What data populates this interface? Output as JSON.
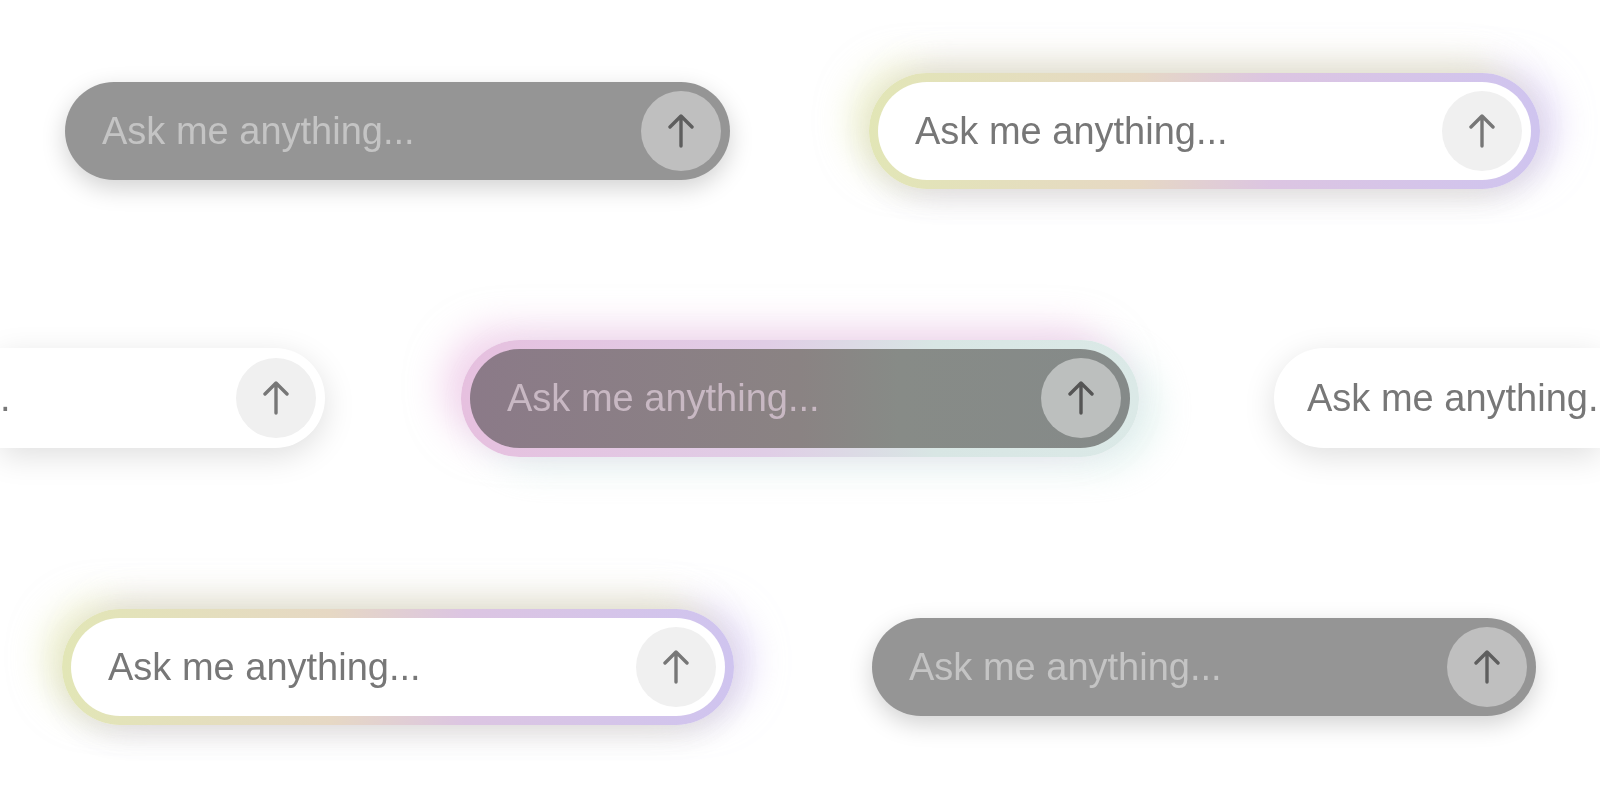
{
  "rows": [
    {
      "fields": [
        {
          "kind": "dark",
          "placeholder": "Ask me anything..."
        },
        {
          "kind": "glow",
          "placeholder": "Ask me anything..."
        }
      ]
    },
    {
      "fields": [
        {
          "kind": "light",
          "placeholder": "."
        },
        {
          "kind": "glowdark",
          "placeholder": "Ask me anything..."
        },
        {
          "kind": "light",
          "placeholder": "Ask me anything."
        }
      ]
    },
    {
      "fields": [
        {
          "kind": "glow",
          "placeholder": "Ask me anything..."
        },
        {
          "kind": "dark",
          "placeholder": "Ask me anything..."
        }
      ]
    }
  ]
}
